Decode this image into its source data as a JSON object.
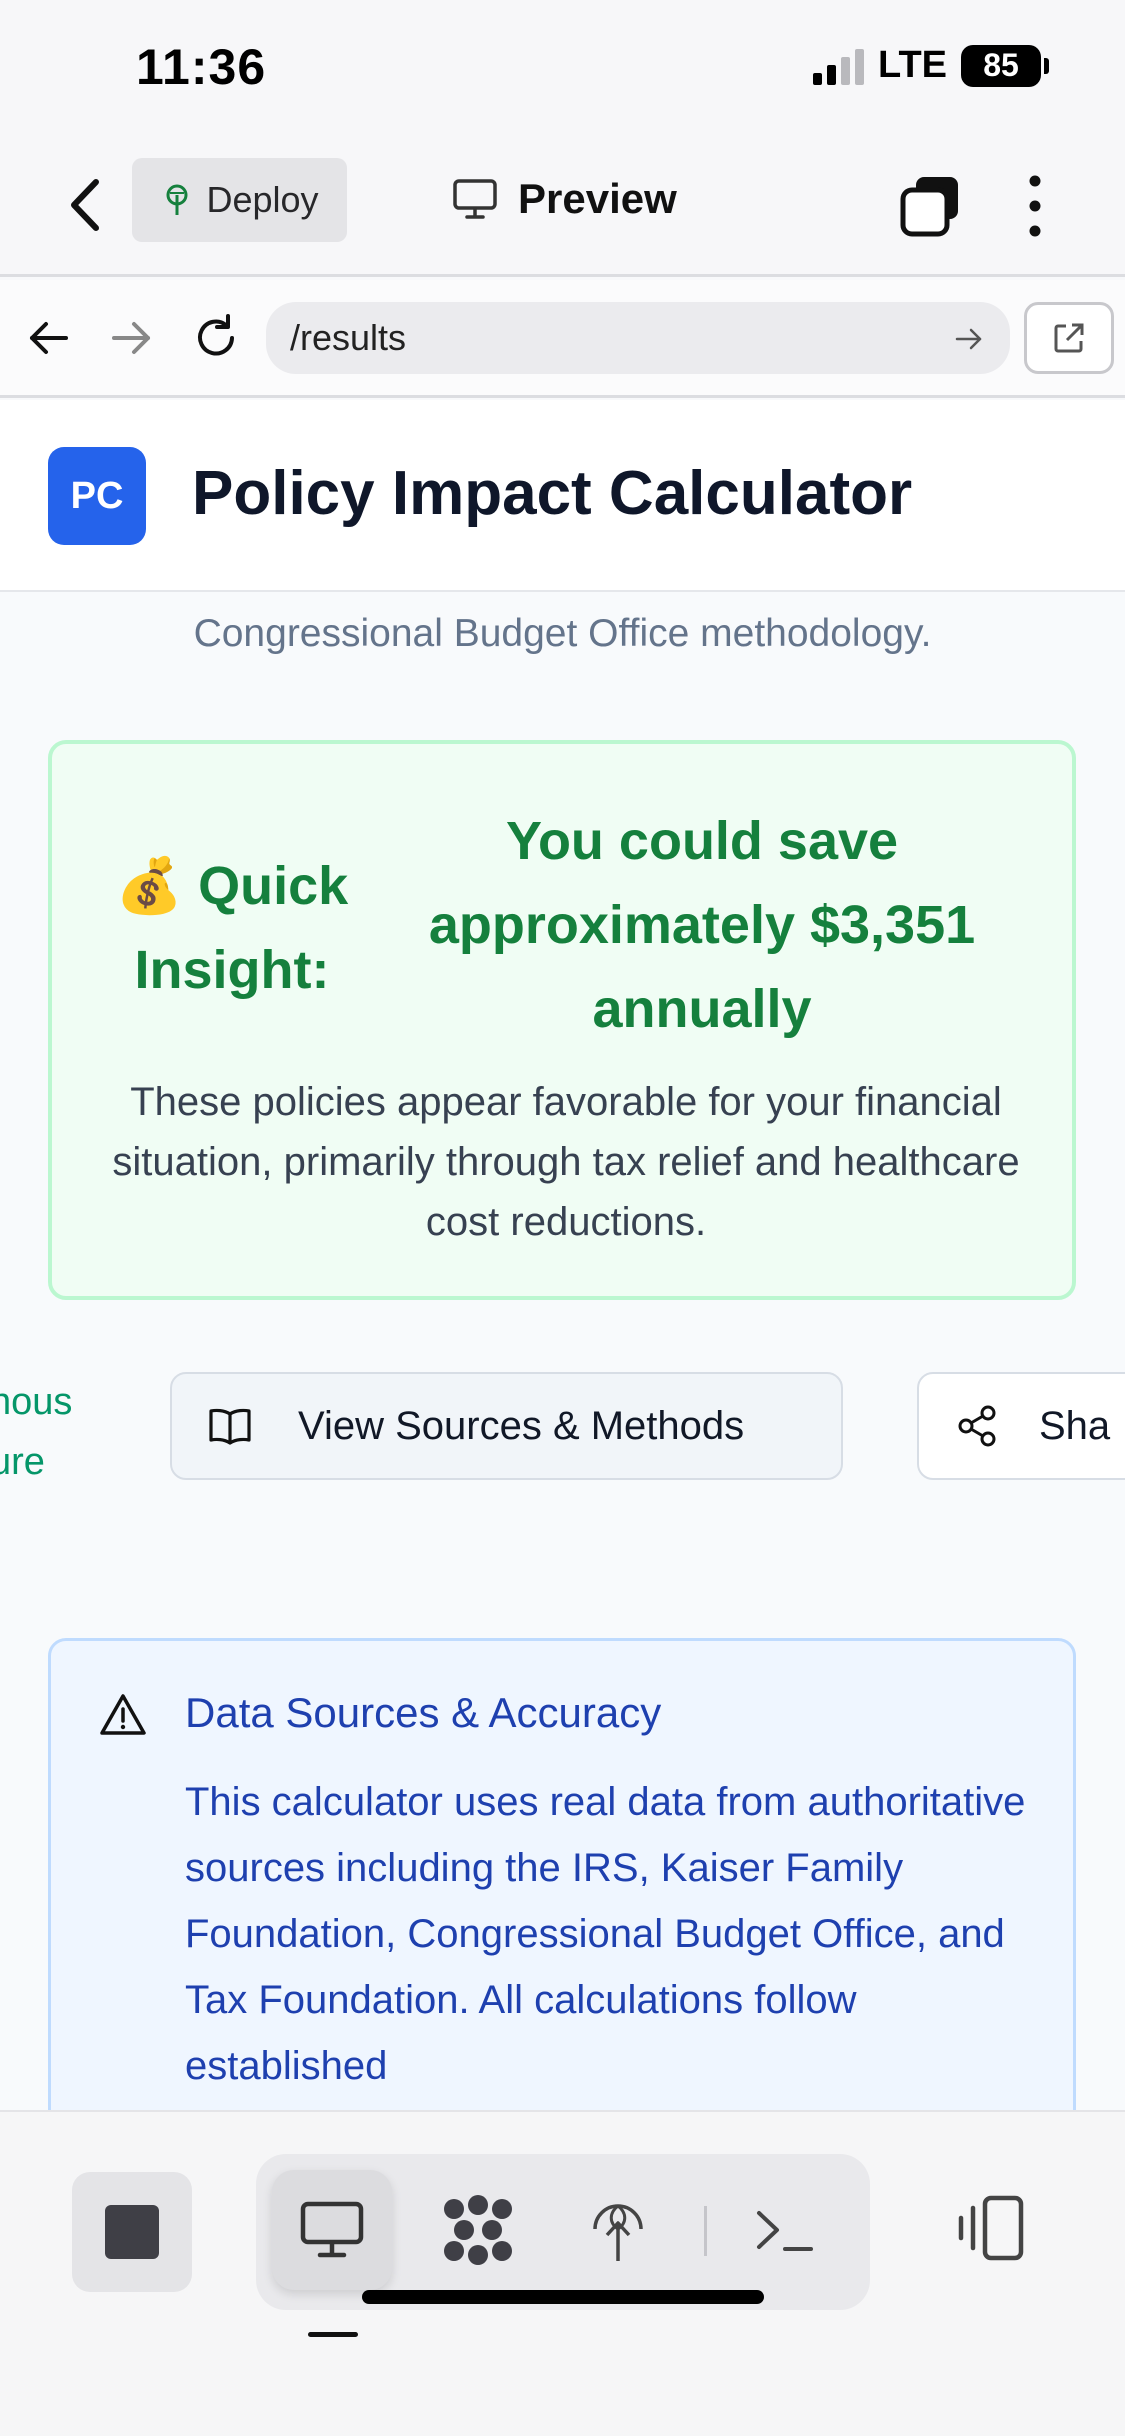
{
  "status_bar": {
    "time": "11:36",
    "network": "LTE",
    "battery": "85"
  },
  "app_header": {
    "deploy_label": "Deploy",
    "preview_label": "Preview"
  },
  "browser": {
    "url": "/results"
  },
  "page": {
    "logo_initials": "PC",
    "title": "Policy Impact Calculator",
    "intro_text": "Congressional Budget Office methodology."
  },
  "insight": {
    "label": "💰 Quick Insight:",
    "value": "You could save approximately $3,351 annually",
    "description": "These policies appear favorable for your financial situation, primarily through tax relief and healthcare cost reductions."
  },
  "actions": {
    "partial_link_line1": "nous",
    "partial_link_line2": "ure",
    "view_sources_label": "View Sources & Methods",
    "share_label": "Sha"
  },
  "data_sources": {
    "title": "Data Sources & Accuracy",
    "text": "This calculator uses real data from authoritative sources including the IRS, Kaiser Family Foundation, Congressional Budget Office, and Tax Foundation. All calculations follow established"
  },
  "colors": {
    "brand": "#2563eb",
    "success": "#15803d",
    "info": "#1e40af"
  },
  "icons": [
    "chevron-left-icon",
    "deploy-icon",
    "monitor-icon",
    "tabs-icon",
    "more-vertical-icon",
    "arrow-left-icon",
    "arrow-right-icon",
    "reload-icon",
    "external-link-icon",
    "book-open-icon",
    "share-icon",
    "warning-icon",
    "stop-icon",
    "desktop-icon",
    "apps-icon",
    "publish-icon",
    "terminal-icon",
    "device-toggle-icon"
  ]
}
